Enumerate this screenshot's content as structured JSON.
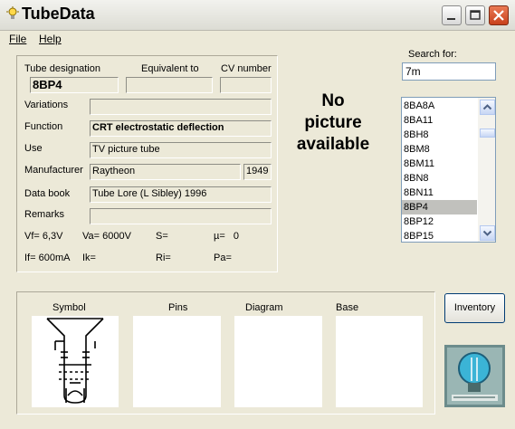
{
  "window": {
    "title": "TubeData"
  },
  "menu": {
    "file": "File",
    "help": "Help"
  },
  "labels": {
    "tube_designation": "Tube designation",
    "equivalent_to": "Equivalent to",
    "cv_number": "CV number",
    "variations": "Variations",
    "function": "Function",
    "use": "Use",
    "manufacturer": "Manufacturer",
    "data_book": "Data book",
    "remarks": "Remarks"
  },
  "fields": {
    "tube_designation": "8BP4",
    "equivalent_to": "",
    "cv_number": "",
    "variations": "",
    "function": "CRT electrostatic deflection",
    "use": "TV picture tube",
    "manufacturer": "Raytheon",
    "year": "1949",
    "data_book": "Tube Lore (L Sibley) 1996",
    "remarks": ""
  },
  "specs": {
    "vf": "Vf= 6,3V",
    "va": "Va= 6000V",
    "s": "S=",
    "mu": "µ=   0",
    "if": "If= 600mA",
    "ik": "Ik=",
    "ri": "Ri=",
    "pa": "Pa="
  },
  "picture": {
    "line1": "No",
    "line2": "picture",
    "line3": "available"
  },
  "search": {
    "label": "Search for:",
    "value": "7m"
  },
  "tube_list": {
    "items": [
      "8BA8A",
      "8BA11",
      "8BH8",
      "8BM8",
      "8BM11",
      "8BN8",
      "8BN11",
      "8BP4",
      "8BP12",
      "8BP15"
    ],
    "selected": "8BP4"
  },
  "bottom": {
    "symbol": "Symbol",
    "pins": "Pins",
    "diagram": "Diagram",
    "base": "Base"
  },
  "buttons": {
    "inventory": "Inventory"
  },
  "colors": {
    "window_bg": "#ece9d8",
    "selection": "#c1c1bd",
    "close_button": "#d9542c"
  }
}
